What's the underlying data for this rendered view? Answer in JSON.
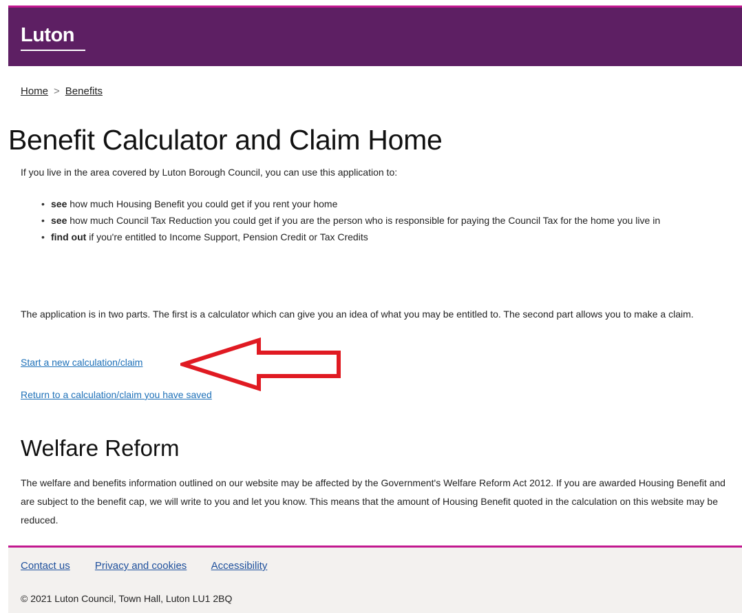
{
  "header": {
    "logo_text": "Luton",
    "brand_color": "#5d1f63",
    "accent_color": "#c2188f"
  },
  "breadcrumb": {
    "items": [
      "Home",
      "Benefits"
    ],
    "separator": ">"
  },
  "main": {
    "title": "Benefit Calculator and Claim Home",
    "intro": "If you live in the area covered by Luton Borough Council, you can use this application to:",
    "bullets": [
      {
        "bold": "see",
        "text": " how much Housing Benefit you could get if you rent your home"
      },
      {
        "bold": "see",
        "text": " how much Council Tax Reduction you could get if you are the person who is responsible for paying the Council Tax for the home you live in"
      },
      {
        "bold": "find out",
        "text": " if you're entitled to Income Support, Pension Credit or Tax Credits"
      }
    ],
    "parts_text": "The application is in two parts. The first is a calculator which can give you an idea of what you may be entitled to. The second part allows you to make a claim.",
    "start_link": "Start a new calculation/claim",
    "return_link": "Return to a calculation/claim you have saved",
    "arrow_color": "#e01a22"
  },
  "welfare": {
    "title": "Welfare Reform",
    "text": "The welfare and benefits information outlined on our website may be affected by the Government's Welfare Reform Act 2012. If you are awarded Housing Benefit and are subject to the benefit cap, we will write to you and let you know. This means that the amount of Housing Benefit quoted in the calculation on this website may be reduced."
  },
  "footer": {
    "links": [
      "Contact us",
      "Privacy and cookies",
      "Accessibility"
    ],
    "copyright": "© 2021 Luton Council, Town Hall, Luton LU1 2BQ"
  }
}
